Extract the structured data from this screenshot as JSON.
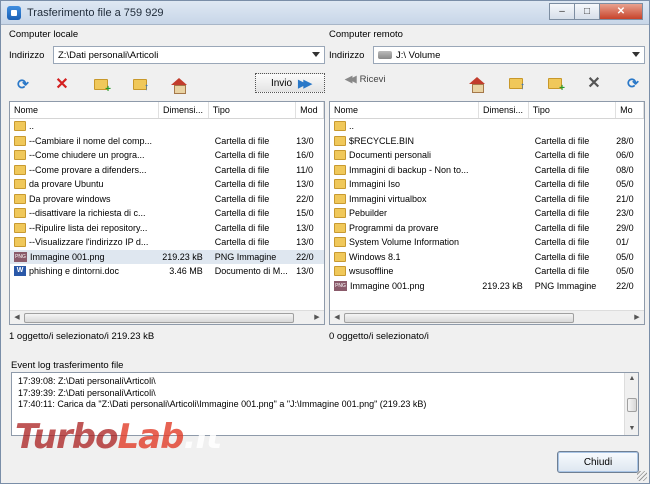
{
  "window": {
    "title": "Trasferimento file a 759 929",
    "minimize_glyph": "–",
    "maximize_glyph": "□",
    "close_glyph": "✕"
  },
  "local": {
    "label": "Computer locale",
    "address_label": "Indirizzo",
    "address_value": "Z:\\Dati personali\\Articoli",
    "send_label": "Invio",
    "columns": [
      "Nome",
      "Dimensi...",
      "Tipo",
      "Mod"
    ],
    "rows": [
      {
        "icon": "folder",
        "name": "..",
        "size": "",
        "type": "",
        "mod": ""
      },
      {
        "icon": "folder",
        "name": "--Cambiare il nome del comp...",
        "size": "",
        "type": "Cartella di file",
        "mod": "13/0"
      },
      {
        "icon": "folder",
        "name": "--Come chiudere un progra...",
        "size": "",
        "type": "Cartella di file",
        "mod": "16/0"
      },
      {
        "icon": "folder",
        "name": "--Come provare a difenders...",
        "size": "",
        "type": "Cartella di file",
        "mod": "11/0"
      },
      {
        "icon": "folder",
        "name": "da provare Ubuntu",
        "size": "",
        "type": "Cartella di file",
        "mod": "13/0"
      },
      {
        "icon": "folder",
        "name": "Da provare windows",
        "size": "",
        "type": "Cartella di file",
        "mod": "22/0"
      },
      {
        "icon": "folder",
        "name": "--disattivare la richiesta di c...",
        "size": "",
        "type": "Cartella di file",
        "mod": "15/0"
      },
      {
        "icon": "folder",
        "name": "--Ripulire lista dei repository...",
        "size": "",
        "type": "Cartella di file",
        "mod": "13/0"
      },
      {
        "icon": "folder",
        "name": "--Visualizzare l'indirizzo IP d...",
        "size": "",
        "type": "Cartella di file",
        "mod": "13/0"
      },
      {
        "icon": "png",
        "name": "Immagine 001.png",
        "size": "219.23 kB",
        "type": "PNG Immagine",
        "mod": "22/0",
        "selected": true
      },
      {
        "icon": "doc",
        "name": "phishing e dintorni.doc",
        "size": "3.46 MB",
        "type": "Documento di M...",
        "mod": "13/0"
      }
    ],
    "status": "1 oggetto/i selezionato/i  219.23 kB"
  },
  "remote": {
    "label": "Computer remoto",
    "address_label": "Indirizzo",
    "address_value": "J:\\ Volume",
    "receive_label": "Ricevi",
    "columns": [
      "Nome",
      "Dimensi...",
      "Tipo",
      "Mo"
    ],
    "rows": [
      {
        "icon": "folder",
        "name": "..",
        "size": "",
        "type": "",
        "mod": ""
      },
      {
        "icon": "folder",
        "name": "$RECYCLE.BIN",
        "size": "",
        "type": "Cartella di file",
        "mod": "28/0"
      },
      {
        "icon": "folder",
        "name": "Documenti personali",
        "size": "",
        "type": "Cartella di file",
        "mod": "06/0"
      },
      {
        "icon": "folder",
        "name": "Immagini di backup - Non to...",
        "size": "",
        "type": "Cartella di file",
        "mod": "08/0"
      },
      {
        "icon": "folder",
        "name": "Immagini Iso",
        "size": "",
        "type": "Cartella di file",
        "mod": "05/0"
      },
      {
        "icon": "folder",
        "name": "Immagini virtualbox",
        "size": "",
        "type": "Cartella di file",
        "mod": "21/0"
      },
      {
        "icon": "folder",
        "name": "Pebuilder",
        "size": "",
        "type": "Cartella di file",
        "mod": "23/0"
      },
      {
        "icon": "folder",
        "name": "Programmi da provare",
        "size": "",
        "type": "Cartella di file",
        "mod": "29/0"
      },
      {
        "icon": "folder",
        "name": "System Volume Information",
        "size": "",
        "type": "Cartella di file",
        "mod": "01/"
      },
      {
        "icon": "folder",
        "name": "Windows 8.1",
        "size": "",
        "type": "Cartella di file",
        "mod": "05/0"
      },
      {
        "icon": "folder",
        "name": "wsusoffline",
        "size": "",
        "type": "Cartella di file",
        "mod": "05/0"
      },
      {
        "icon": "png",
        "name": "Immagine 001.png",
        "size": "219.23 kB",
        "type": "PNG Immagine",
        "mod": "22/0"
      }
    ],
    "status": "0 oggetto/i selezionato/i"
  },
  "event_log": {
    "label": "Event log trasferimento file",
    "lines": [
      "17:39:08: Z:\\Dati personali\\Articoli\\",
      "17:39:39: Z:\\Dati personali\\Articoli\\",
      "17:40:11: Carica da \"Z:\\Dati personali\\Articoli\\Immagine 001.png\" a \"J:\\Immagine 001.png\" (219.23 kB)"
    ]
  },
  "close_button": "Chiudi",
  "watermark": {
    "part1": "Turbo",
    "part2": "Lab",
    "part3": ".it"
  }
}
